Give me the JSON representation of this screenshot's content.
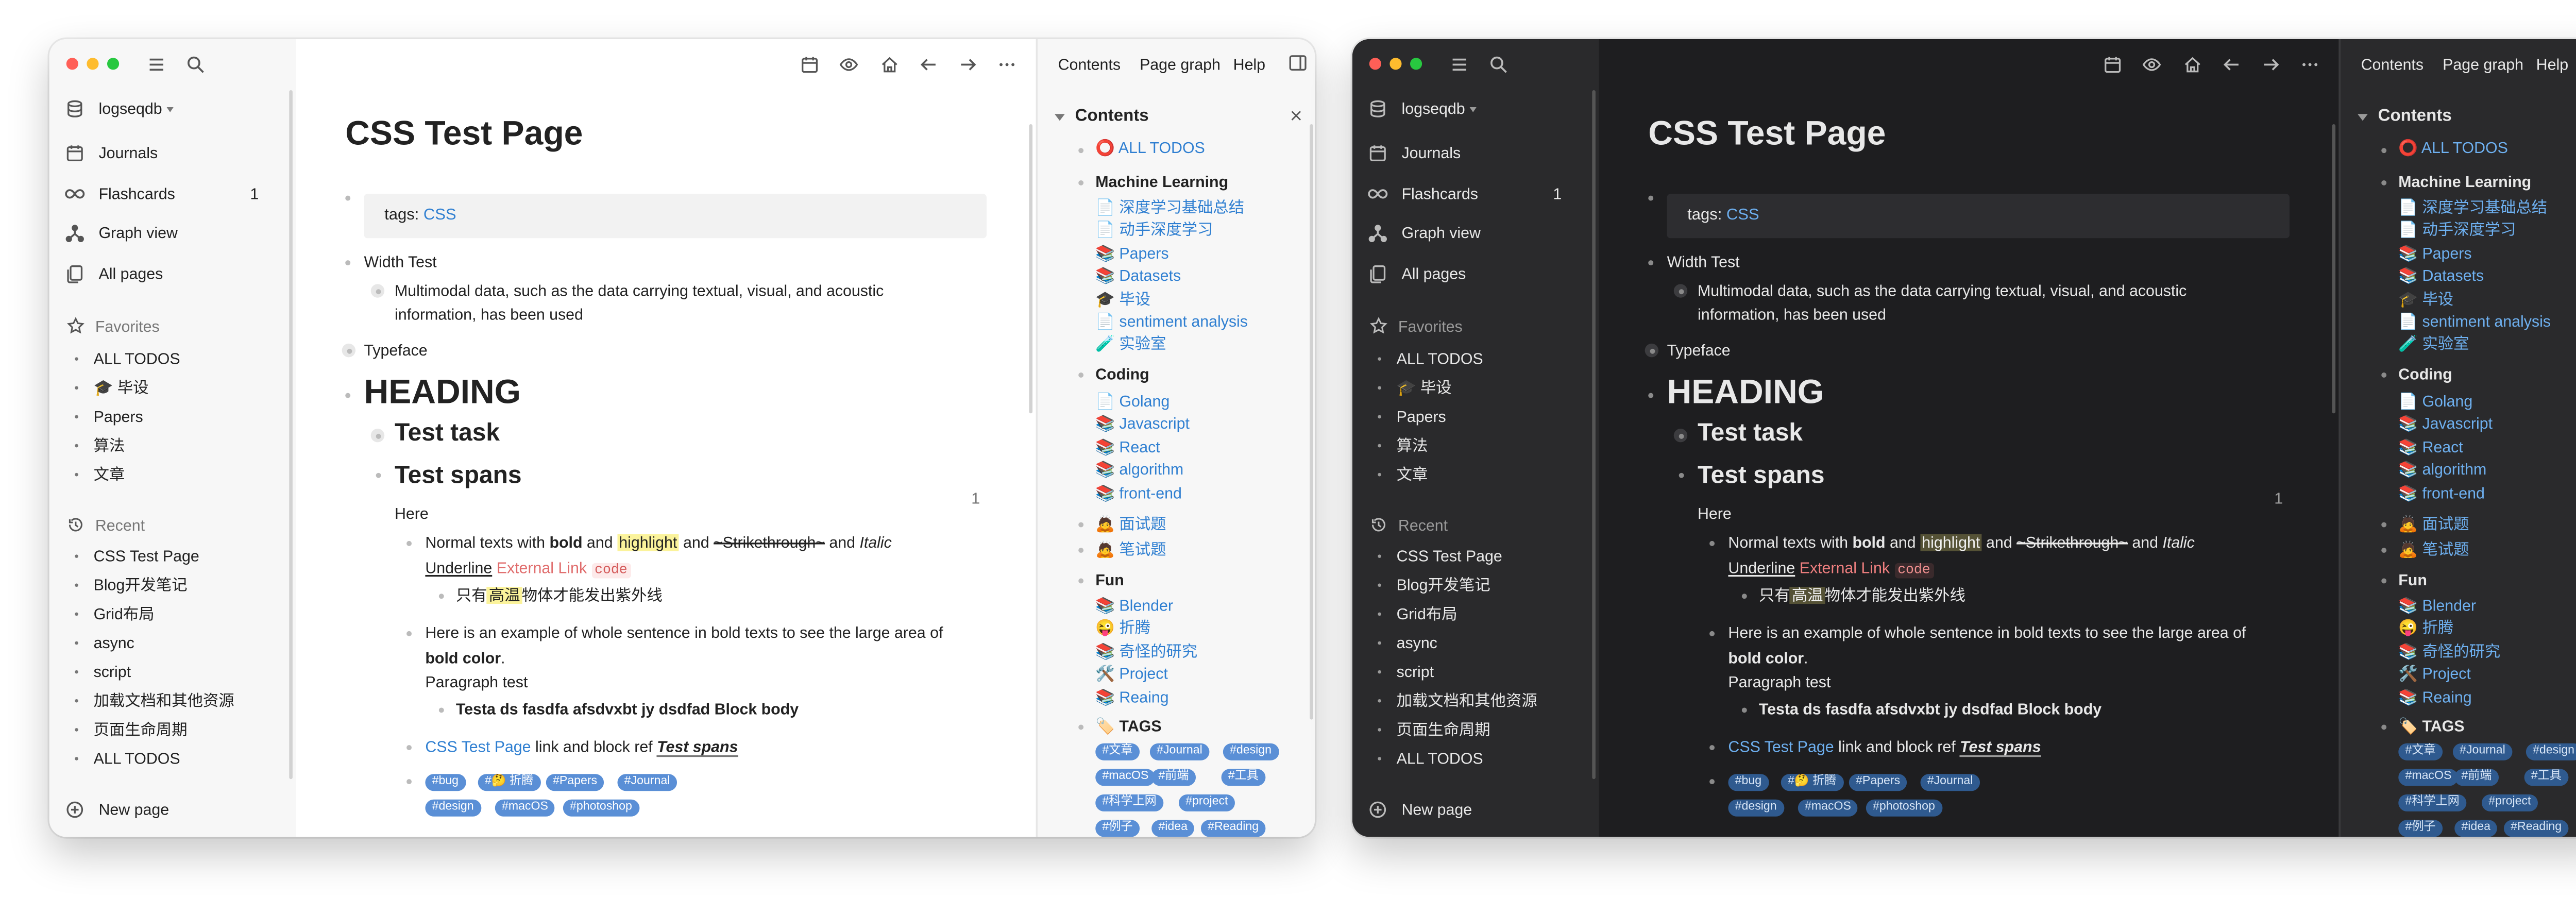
{
  "sidebar": {
    "graph_name": "logseqdb",
    "nav": [
      {
        "label": "Journals",
        "icon": "calendar-icon"
      },
      {
        "label": "Flashcards",
        "icon": "infinity-icon",
        "badge": "1"
      },
      {
        "label": "Graph view",
        "icon": "graph-icon"
      },
      {
        "label": "All pages",
        "icon": "pages-icon"
      }
    ],
    "favorites_title": "Favorites",
    "favorites": [
      "ALL TODOS",
      "🎓 毕设",
      "Papers",
      "算法",
      "文章"
    ],
    "recent_title": "Recent",
    "recent": [
      "CSS Test Page",
      "Blog开发笔记",
      "Grid布局",
      "async",
      "script",
      "加载文档和其他资源",
      "页面生命周期",
      "ALL TODOS"
    ],
    "new_page": "New page"
  },
  "toolbar": {
    "icons": [
      "calendar-icon",
      "eye-icon",
      "home-icon",
      "arrow-left-icon",
      "arrow-right-icon",
      "more-icon"
    ]
  },
  "right_tabs": [
    "Contents",
    "Page graph",
    "Help"
  ],
  "page": {
    "title": "CSS Test Page",
    "tags_label": "tags:",
    "tags_value": "CSS",
    "width_test": "Width Test",
    "multimodal_line1": "Multimodal data, such as the data carrying textual, visual, and acoustic",
    "multimodal_line2": "information, has been used",
    "typeface": "Typeface",
    "heading": "HEADING",
    "test_task": "Test task",
    "test_spans": "Test spans",
    "ref_count": "1",
    "here": "Here",
    "normal_a": "Normal texts with ",
    "bold": "bold",
    "and1": " and ",
    "highlight": "highlight",
    "and2": " and ",
    "strike": "~Strikethrough~",
    "and3": " and ",
    "italic": "Italic",
    "underline": "Underline",
    "external_link": "External Link",
    "code": "code",
    "cjk_a": "只有",
    "cjk_hl": "高温",
    "cjk_b": "物体才能发出紫外线",
    "example_line1": "Here is an example of whole sentence in bold texts to see the large area of",
    "bold_color": "bold color",
    "period": ".",
    "paragraph_test": "Paragraph test",
    "testa": "Testa ds fasdfa afsdvxbt jy dsdfad Block body",
    "css_link": "CSS Test Page",
    "link_block_ref": " link and block ref ",
    "block_ref": "Test spans",
    "page_tags": [
      "#bug",
      "#🤔 折腾",
      "#Papers",
      "#Journal",
      "#design",
      "#macOS",
      "#photoshop"
    ]
  },
  "contents": {
    "title": "Contents",
    "all_todos": "⭕ ALL TODOS",
    "sections": [
      {
        "title": "Machine Learning",
        "items": [
          "📄 深度学习基础总结",
          "📄 动手深度学习",
          "📚 Papers",
          "📚 Datasets",
          "🎓 毕设",
          "📄 sentiment analysis",
          "🧪 实验室"
        ]
      },
      {
        "title": "Coding",
        "items": [
          "📄 Golang",
          "📚 Javascript",
          "📚 React",
          "📚 algorithm",
          "📚 front-end"
        ]
      },
      {
        "title": "",
        "items": [
          "🙇 面试题",
          "🙇 笔试题"
        ]
      },
      {
        "title": "Fun",
        "items": [
          "📚 Blender",
          "😜 折腾",
          "📚 奇怪的研究",
          "🛠️ Project",
          "📚 Reaing"
        ]
      }
    ],
    "tags_title": "🏷️ TAGS",
    "tags": [
      "#文章",
      "#Journal",
      "#design",
      "#macOS",
      "#前端",
      "#工具",
      "#科学上网",
      "#project",
      "#例子",
      "#idea",
      "#Reading"
    ]
  },
  "theme_colors": {
    "light_bg": "#ffffff",
    "dark_bg": "#1e1e20",
    "link_light": "#2f7fd1",
    "link_dark": "#6eb0f0",
    "traffic_red": "#ff5f57",
    "traffic_yellow": "#febc2e",
    "traffic_green": "#28c840"
  }
}
